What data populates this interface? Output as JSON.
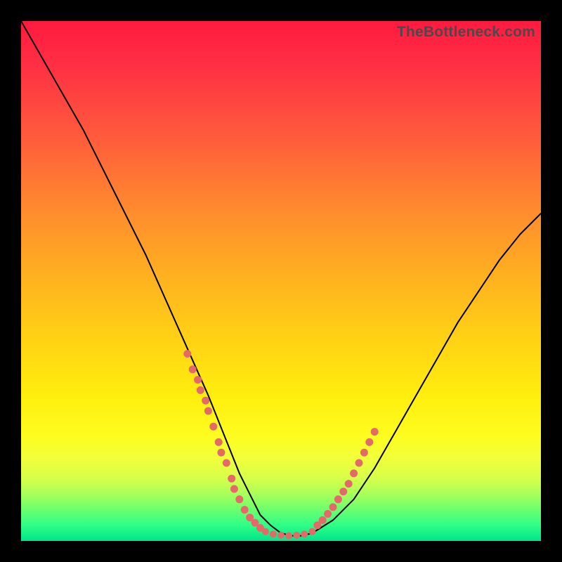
{
  "watermark": "TheBottleneck.com",
  "colors": {
    "frame": "#000000",
    "gradient_top": "#ff1a3f",
    "gradient_bottom": "#00e48a",
    "curve": "#000000",
    "bead": "#e46a6a"
  },
  "chart_data": {
    "type": "line",
    "title": "",
    "xlabel": "",
    "ylabel": "",
    "xlim": [
      0,
      100
    ],
    "ylim": [
      0,
      100
    ],
    "grid": false,
    "curve": {
      "x": [
        0,
        4,
        8,
        12,
        16,
        20,
        24,
        28,
        32,
        36,
        38,
        40,
        42,
        44,
        46,
        48,
        50,
        52,
        54,
        56,
        60,
        64,
        68,
        72,
        76,
        80,
        84,
        88,
        92,
        96,
        100
      ],
      "y": [
        100,
        93,
        86,
        79,
        71,
        63,
        55,
        46,
        37,
        28,
        23,
        18,
        13,
        9,
        5,
        3,
        1.5,
        1,
        1,
        1.5,
        4,
        8,
        14,
        21,
        28,
        35,
        42,
        48,
        54,
        59,
        63
      ]
    },
    "beads_left": {
      "x": [
        32,
        33,
        34,
        34.5,
        35.5,
        36,
        37,
        38,
        38.5,
        39.5,
        40.5,
        41,
        42,
        43,
        44,
        45,
        46
      ],
      "y": [
        36,
        33,
        31,
        29,
        27,
        25,
        22,
        19,
        17,
        15,
        12,
        10,
        8,
        6,
        4.5,
        3.5,
        2.5
      ]
    },
    "beads_bottom": {
      "x": [
        47,
        48.5,
        50,
        51.5,
        53,
        54.5,
        56
      ],
      "y": [
        1.8,
        1.3,
        1.1,
        1,
        1.1,
        1.3,
        1.8
      ]
    },
    "beads_right": {
      "x": [
        57,
        58,
        59,
        60,
        61,
        62,
        63,
        64,
        65,
        66,
        67,
        68
      ],
      "y": [
        3,
        4,
        5.2,
        6.5,
        8,
        9.5,
        11,
        13,
        15,
        17,
        19,
        21
      ]
    }
  }
}
